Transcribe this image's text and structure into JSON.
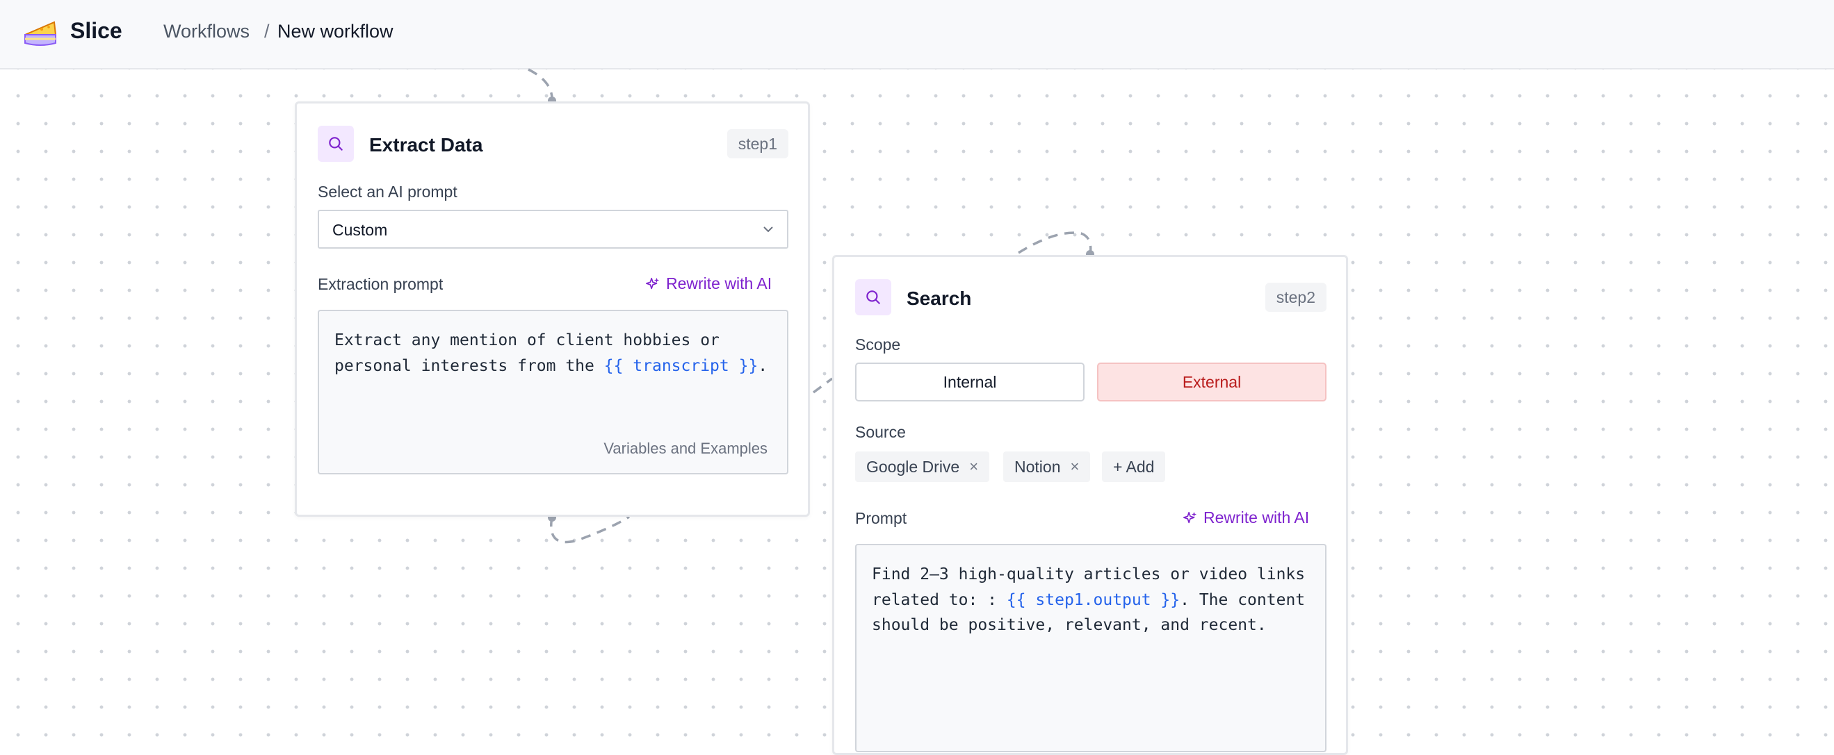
{
  "header": {
    "app_name": "Slice",
    "breadcrumb": {
      "parent": "Workflows",
      "separator": "/",
      "current": "New workflow"
    }
  },
  "nodes": [
    {
      "title": "Extract Data",
      "step": "step1",
      "icon": "search-icon",
      "select_label": "Select an AI prompt",
      "select_value": "Custom",
      "prompt_label": "Extraction prompt",
      "rewrite_label": "Rewrite with AI",
      "prompt_before": "Extract any mention of client hobbies or\npersonal interests from the ",
      "prompt_var": "{{ transcript }}",
      "prompt_after": ".",
      "helper": "Variables and Examples"
    },
    {
      "title": "Search",
      "step": "step2",
      "icon": "search-icon",
      "scope_label": "Scope",
      "scope_options": [
        "Internal",
        "External"
      ],
      "scope_selected": "External",
      "source_label": "Source",
      "sources": [
        "Google Drive",
        "Notion"
      ],
      "add_label": "+ Add",
      "remove_symbol": "×",
      "prompt_label": "Prompt",
      "rewrite_label": "Rewrite with AI",
      "prompt_before": "Find 2–3 high-quality articles or video links\nrelated to: : ",
      "prompt_var": "{{ step1.output }}",
      "prompt_after": ". The content\nshould be positive, relevant, and recent."
    }
  ],
  "colors": {
    "accent_purple": "#7e22ce",
    "variable_blue": "#2563eb",
    "external_bg": "#fde3e3",
    "external_text": "#b91c1c"
  }
}
